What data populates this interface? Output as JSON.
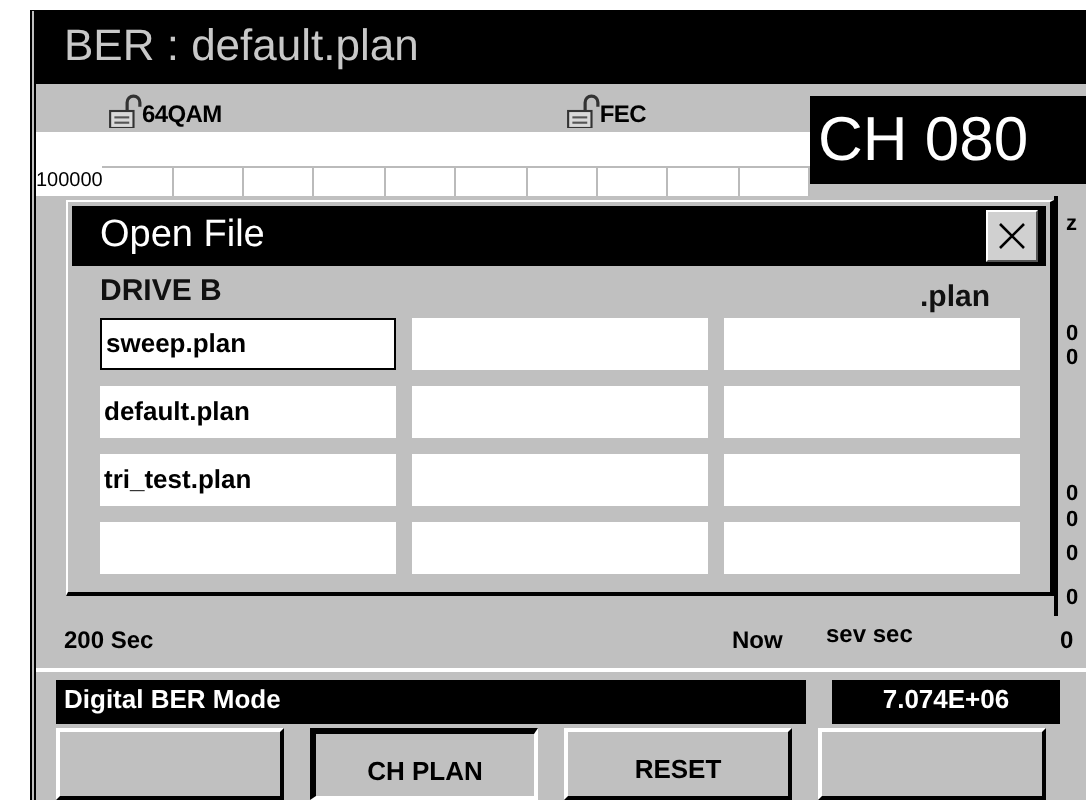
{
  "window": {
    "title": "BER : default.plan"
  },
  "indicators": [
    {
      "label": "64QAM",
      "locked": false
    },
    {
      "label": "FEC",
      "locked": false
    }
  ],
  "channel": "CH 080",
  "chart": {
    "scale": "100000"
  },
  "edge_fragments": [
    "z",
    "0",
    "0",
    "0",
    "0",
    "0",
    "0"
  ],
  "dialog": {
    "title": "Open File",
    "drive": "DRIVE B",
    "extension": ".plan",
    "files": [
      {
        "name": "sweep.plan",
        "selected": true
      },
      {
        "selected": false
      },
      {
        "selected": false
      },
      {
        "name": "default.plan",
        "selected": false
      },
      {
        "selected": false
      },
      {
        "selected": false
      },
      {
        "name": "tri_test.plan",
        "selected": false
      },
      {
        "selected": false
      },
      {
        "selected": false
      },
      {
        "selected": false
      },
      {
        "selected": false
      },
      {
        "selected": false
      }
    ]
  },
  "time_axis": {
    "start": "200 Sec",
    "end": "Now",
    "metric": "sev sec",
    "value": "0"
  },
  "status_bar": {
    "mode": "Digital BER Mode",
    "reading": "7.074E+06"
  },
  "buttons": [
    {
      "selected": false
    },
    {
      "label": "CH PLAN",
      "selected": true
    },
    {
      "label": "RESET",
      "selected": false
    },
    {
      "selected": false
    }
  ]
}
